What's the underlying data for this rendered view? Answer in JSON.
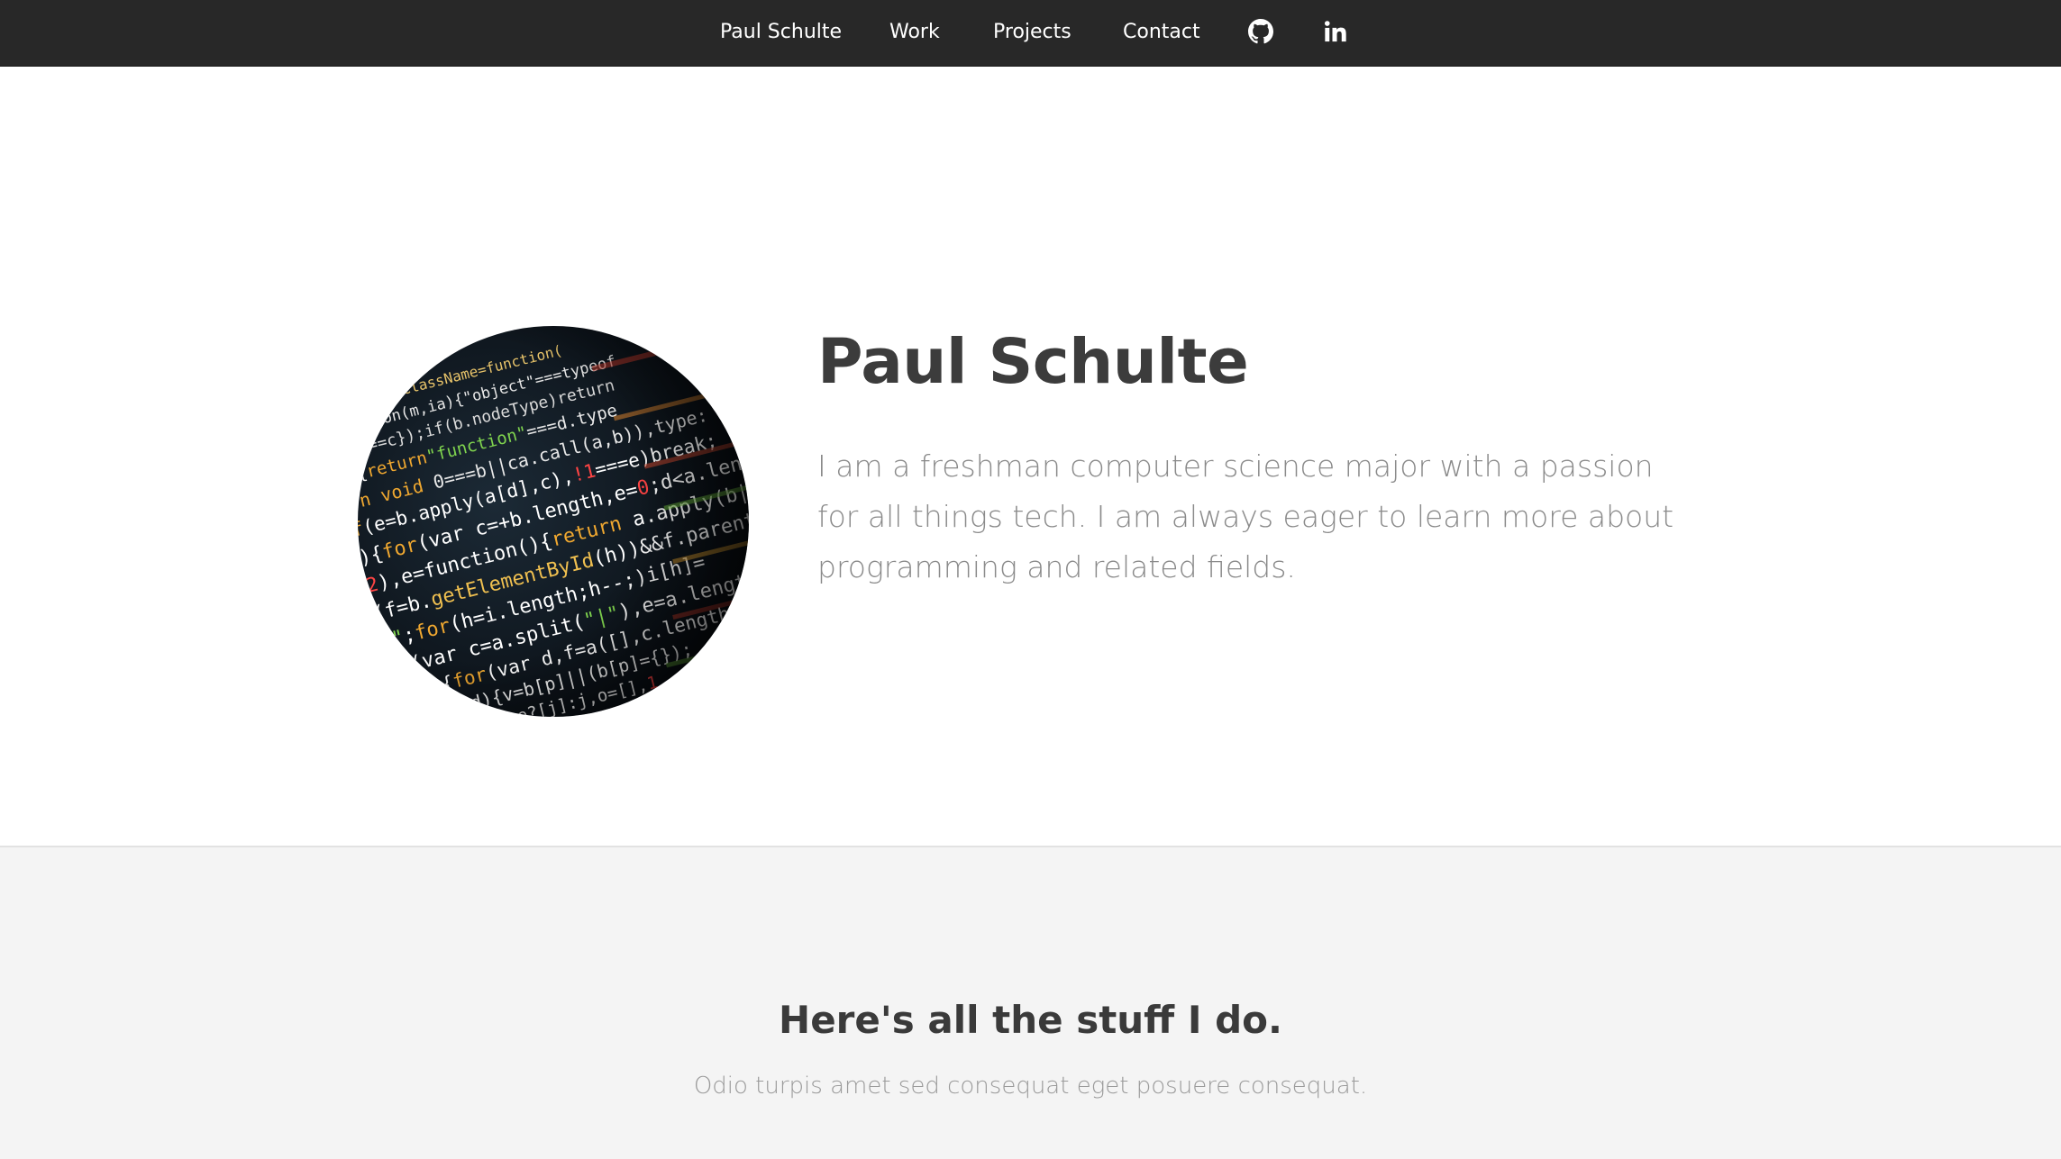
{
  "nav": {
    "brand": "Paul Schulte",
    "items": [
      "Work",
      "Projects",
      "Contact"
    ],
    "icons": [
      "github-icon",
      "linkedin-icon"
    ],
    "background": "#282828"
  },
  "hero": {
    "title": "Paul Schulte",
    "text": "I am a freshman computer science major with a passion for all things tech. I am always eager to learn more about programming and related fields.",
    "image": "code-screen-photo"
  },
  "features": {
    "title": "Here's all the stuff I do.",
    "subtitle": "Odio turpis amet sed consequat eget posuere consequat."
  }
}
